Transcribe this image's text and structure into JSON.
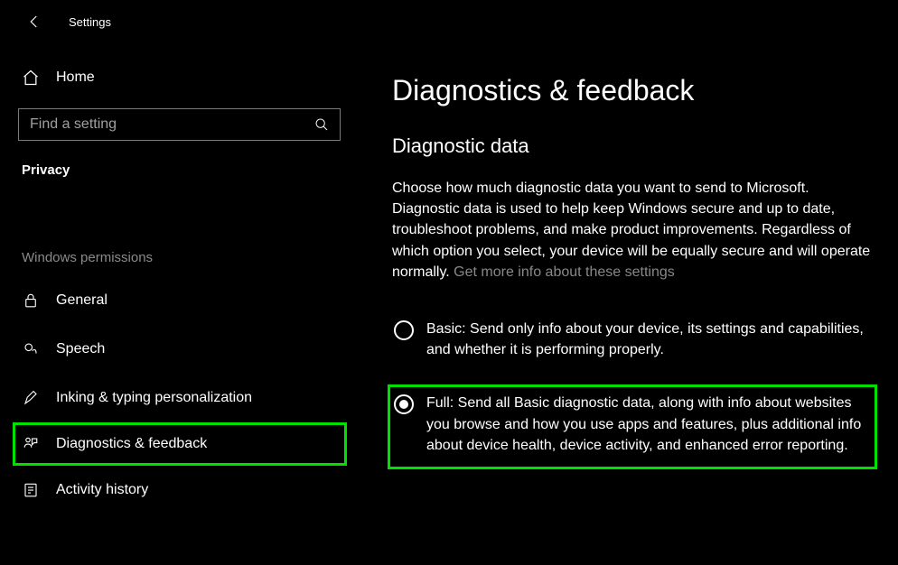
{
  "header": {
    "title": "Settings"
  },
  "sidebar": {
    "home": "Home",
    "search_placeholder": "Find a setting",
    "section": "Privacy",
    "group": "Windows permissions",
    "items": [
      {
        "label": "General"
      },
      {
        "label": "Speech"
      },
      {
        "label": "Inking & typing personalization"
      },
      {
        "label": "Diagnostics & feedback"
      },
      {
        "label": "Activity history"
      }
    ]
  },
  "main": {
    "title": "Diagnostics & feedback",
    "section": "Diagnostic data",
    "desc": "Choose how much diagnostic data you want to send to Microsoft. Diagnostic data is used to help keep Windows secure and up to date, troubleshoot problems, and make product improvements. Regardless of which option you select, your device will be equally secure and will operate normally. ",
    "desc_link": "Get more info about these settings",
    "options": [
      {
        "label": "Basic: Send only info about your device, its settings and capabilities, and whether it is performing properly.",
        "checked": false
      },
      {
        "label": "Full: Send all Basic diagnostic data, along with info about websites you browse and how you use apps and features, plus additional info about device health, device activity, and enhanced error reporting.",
        "checked": true
      }
    ]
  }
}
